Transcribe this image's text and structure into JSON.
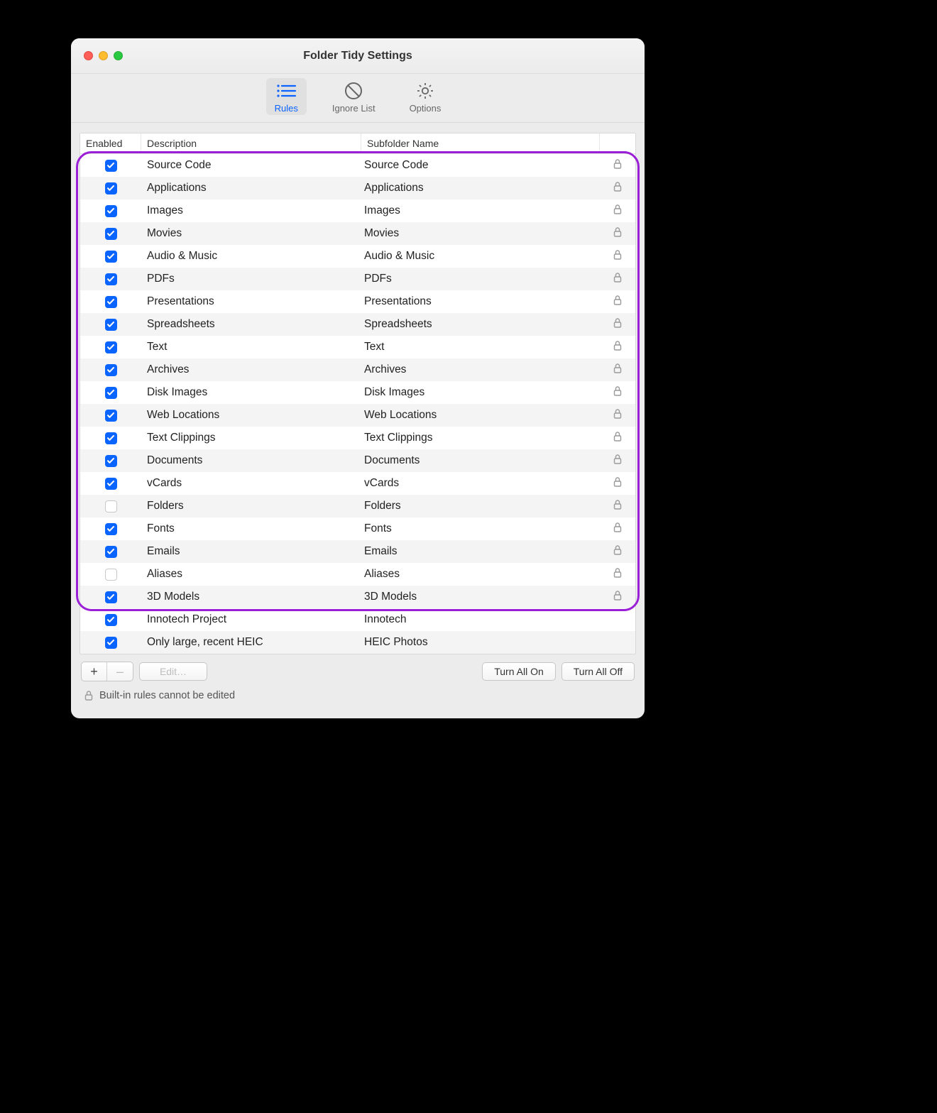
{
  "window": {
    "title": "Folder Tidy Settings"
  },
  "toolbar": {
    "items": [
      {
        "id": "rules",
        "label": "Rules",
        "selected": true
      },
      {
        "id": "ignore",
        "label": "Ignore List",
        "selected": false
      },
      {
        "id": "options",
        "label": "Options",
        "selected": false
      }
    ]
  },
  "table": {
    "headers": {
      "enabled": "Enabled",
      "description": "Description",
      "subfolder": "Subfolder Name"
    },
    "rows": [
      {
        "enabled": true,
        "description": "Source Code",
        "subfolder": "Source Code",
        "locked": true
      },
      {
        "enabled": true,
        "description": "Applications",
        "subfolder": "Applications",
        "locked": true
      },
      {
        "enabled": true,
        "description": "Images",
        "subfolder": "Images",
        "locked": true
      },
      {
        "enabled": true,
        "description": "Movies",
        "subfolder": "Movies",
        "locked": true
      },
      {
        "enabled": true,
        "description": "Audio & Music",
        "subfolder": "Audio & Music",
        "locked": true
      },
      {
        "enabled": true,
        "description": "PDFs",
        "subfolder": "PDFs",
        "locked": true
      },
      {
        "enabled": true,
        "description": "Presentations",
        "subfolder": "Presentations",
        "locked": true
      },
      {
        "enabled": true,
        "description": "Spreadsheets",
        "subfolder": "Spreadsheets",
        "locked": true
      },
      {
        "enabled": true,
        "description": "Text",
        "subfolder": "Text",
        "locked": true
      },
      {
        "enabled": true,
        "description": "Archives",
        "subfolder": "Archives",
        "locked": true
      },
      {
        "enabled": true,
        "description": "Disk Images",
        "subfolder": "Disk Images",
        "locked": true
      },
      {
        "enabled": true,
        "description": "Web Locations",
        "subfolder": "Web Locations",
        "locked": true
      },
      {
        "enabled": true,
        "description": "Text Clippings",
        "subfolder": "Text Clippings",
        "locked": true
      },
      {
        "enabled": true,
        "description": "Documents",
        "subfolder": "Documents",
        "locked": true
      },
      {
        "enabled": true,
        "description": "vCards",
        "subfolder": "vCards",
        "locked": true
      },
      {
        "enabled": false,
        "description": "Folders",
        "subfolder": "Folders",
        "locked": true
      },
      {
        "enabled": true,
        "description": "Fonts",
        "subfolder": "Fonts",
        "locked": true
      },
      {
        "enabled": true,
        "description": "Emails",
        "subfolder": "Emails",
        "locked": true
      },
      {
        "enabled": false,
        "description": "Aliases",
        "subfolder": "Aliases",
        "locked": true
      },
      {
        "enabled": true,
        "description": "3D Models",
        "subfolder": "3D Models",
        "locked": true
      },
      {
        "enabled": true,
        "description": "Innotech Project",
        "subfolder": "Innotech",
        "locked": false
      },
      {
        "enabled": true,
        "description": "Only large, recent HEIC",
        "subfolder": "HEIC Photos",
        "locked": false
      }
    ]
  },
  "highlight": {
    "from_row": 0,
    "to_row": 19
  },
  "buttons": {
    "add": "+",
    "remove": "–",
    "edit": "Edit…",
    "turn_all_on": "Turn All On",
    "turn_all_off": "Turn All Off"
  },
  "footnote": "Built-in rules cannot be edited",
  "colors": {
    "accent": "#0a64ff",
    "highlight": "#9a1fd6"
  }
}
